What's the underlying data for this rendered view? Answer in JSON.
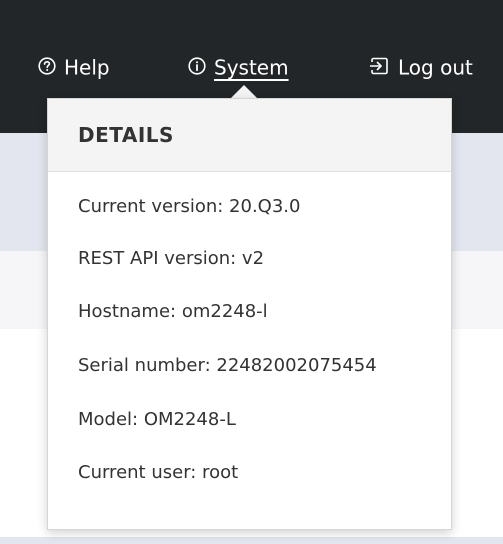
{
  "nav": {
    "help": {
      "label": "Help",
      "icon": "question-circle-icon"
    },
    "system": {
      "label": "System",
      "icon": "info-circle-icon"
    },
    "logout": {
      "label": "Log out",
      "icon": "logout-icon"
    }
  },
  "details": {
    "heading": "DETAILS",
    "items": [
      "Current version: 20.Q3.0",
      "REST API version: v2",
      "Hostname: om2248-l",
      "Serial number: 22482002075454",
      "Model: OM2248-L",
      "Current user: root"
    ]
  },
  "colors": {
    "topbar": "#232628",
    "dropdown_header": "#f4f4f4"
  }
}
